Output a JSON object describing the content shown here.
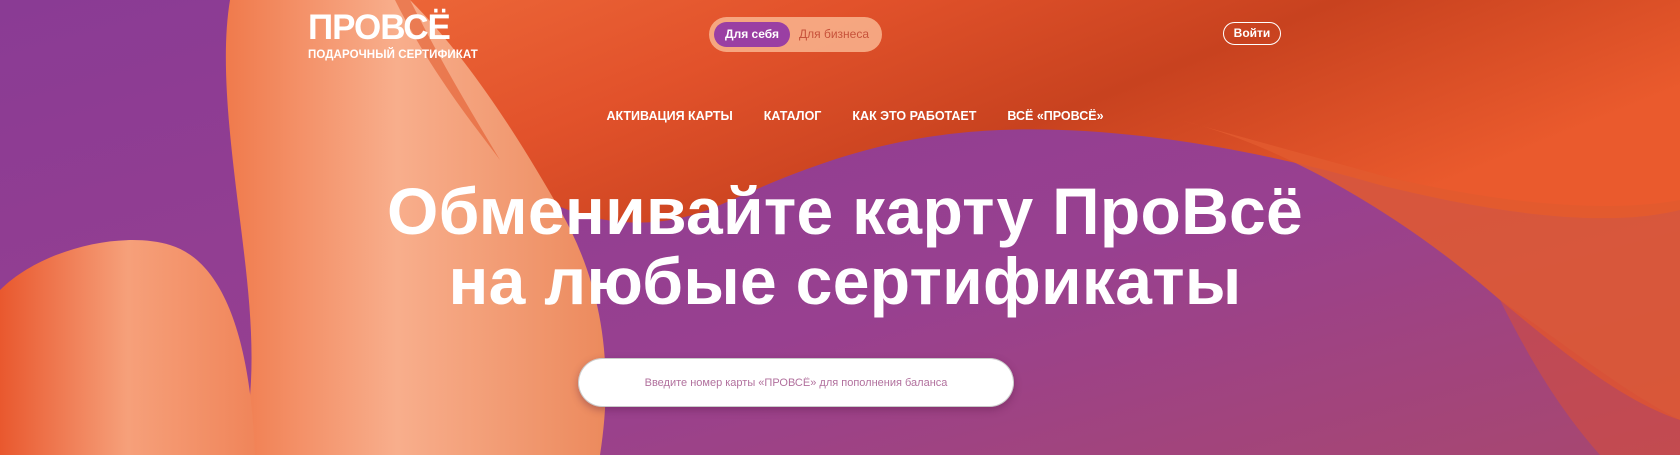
{
  "brand": {
    "logo_text": "ПРОВСЁ",
    "logo_subtitle": "ПОДАРОЧНЫЙ СЕРТИФИКАТ"
  },
  "segment": {
    "personal_label": "Для себя",
    "business_label": "Для бизнеса",
    "selected": "personal"
  },
  "header": {
    "login_label": "Войти"
  },
  "nav": {
    "items": [
      {
        "label": "АКТИВАЦИЯ КАРТЫ"
      },
      {
        "label": "КАТАЛОГ"
      },
      {
        "label": "КАК ЭТО РАБОТАЕТ"
      },
      {
        "label": "ВСЁ «ПРОВСЁ»"
      }
    ]
  },
  "hero": {
    "headline_line1": "Обменивайте карту ПроВсё",
    "headline_line2": "на любые сертификаты"
  },
  "search": {
    "value": "",
    "placeholder": "Введите номер карты «ПРОВСЁ» для пополнения баланса"
  },
  "colors": {
    "purple": "#8e3c8f",
    "orange": "#e8552a",
    "peach": "#f4a47f",
    "active_pill": "#9a3fa3"
  }
}
